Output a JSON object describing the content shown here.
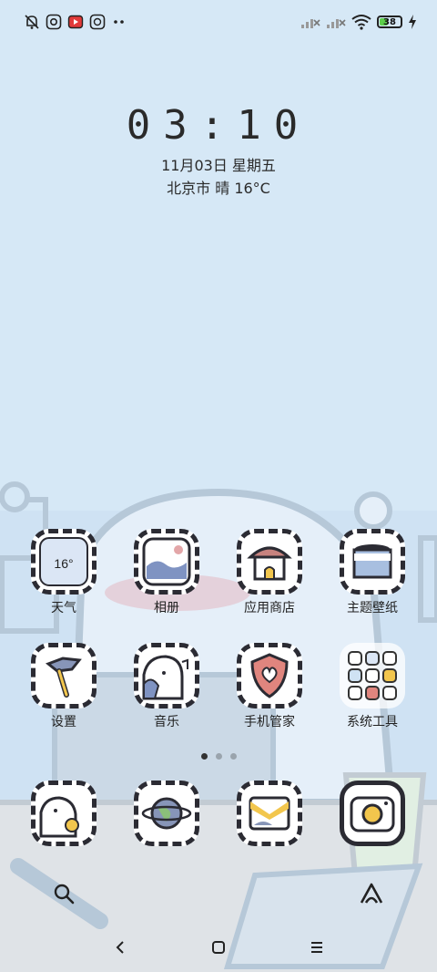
{
  "statusbar": {
    "battery_level": "38",
    "battery_fraction": 0.38,
    "left_icons": [
      "bell-muted-icon",
      "camera-app-icon",
      "video-app-icon",
      "chat-app-icon",
      "more-dots-icon"
    ],
    "right_icons": [
      "signal-no-service-icon",
      "signal-no-service-icon",
      "wifi-icon",
      "battery-icon",
      "charging-icon"
    ]
  },
  "clock": {
    "time": "03:10",
    "date": "11月03日 星期五",
    "weather": "北京市 晴 16°C"
  },
  "apps": [
    {
      "label": "天气",
      "icon": "weather-icon",
      "badge": "16°"
    },
    {
      "label": "相册",
      "icon": "gallery-icon"
    },
    {
      "label": "应用商店",
      "icon": "app-store-icon"
    },
    {
      "label": "主题壁纸",
      "icon": "themes-icon"
    },
    {
      "label": "设置",
      "icon": "settings-icon"
    },
    {
      "label": "音乐",
      "icon": "music-icon"
    },
    {
      "label": "手机管家",
      "icon": "security-icon"
    },
    {
      "label": "系统工具",
      "icon": "system-tools-folder-icon"
    }
  ],
  "dock": [
    {
      "icon": "phone-icon"
    },
    {
      "icon": "browser-icon"
    },
    {
      "icon": "messages-icon"
    },
    {
      "icon": "camera-icon"
    }
  ],
  "page_indicator": {
    "count": 3,
    "active": 0
  },
  "search": {
    "left_icon": "search-icon",
    "right_icon": "assistant-icon"
  },
  "navbar": {
    "back": "back-icon",
    "home": "home-icon",
    "recents": "menu-icon"
  },
  "colors": {
    "wallpaper_sky": "#d6e8f6",
    "tile_border": "#2b2b33",
    "battery_fill": "#5ccf4a"
  }
}
